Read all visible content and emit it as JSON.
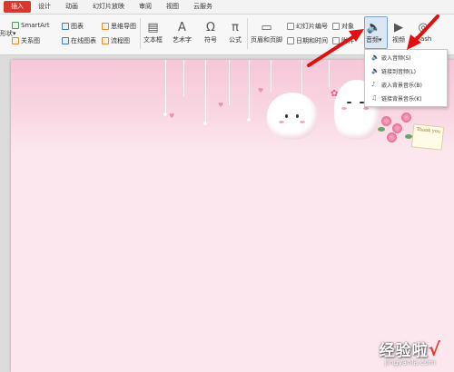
{
  "tabs": [
    "插入",
    "设计",
    "动画",
    "幻灯片放映",
    "审阅",
    "视图",
    "云服务"
  ],
  "ribbon": {
    "shape_label": "形状",
    "smartart": "SmartArt",
    "chart": "图表",
    "mindmap": "思维导图",
    "relation": "关系图",
    "online_chart": "在线图表",
    "flowchart": "流程图",
    "textbox": "文本框",
    "wordart": "艺术字",
    "symbol": "符号",
    "formula": "公式",
    "header_footer": "页眉和页脚",
    "slide_number": "幻灯片编号",
    "object": "对象",
    "datetime": "日期和时间",
    "attachment": "附件",
    "audio": "音频",
    "video": "视频",
    "flash": "Flash"
  },
  "audio_menu": [
    {
      "label": "嵌入音频(S)",
      "icon": "speaker-icon"
    },
    {
      "label": "链接到音频(L)",
      "icon": "link-audio-icon"
    },
    {
      "label": "嵌入背景音乐(B)",
      "icon": "music-note-icon"
    },
    {
      "label": "链接背景音乐(K)",
      "icon": "music-link-icon"
    }
  ],
  "slide": {
    "card_text": "Thank you"
  },
  "watermark": {
    "title": "经验啦",
    "check": "√",
    "url": "jingyanla.com"
  },
  "colors": {
    "active_tab": "#d9382f",
    "arrow": "#e01010",
    "slide_bg": "#fce7ef",
    "highlight": "#dbe7f5"
  }
}
